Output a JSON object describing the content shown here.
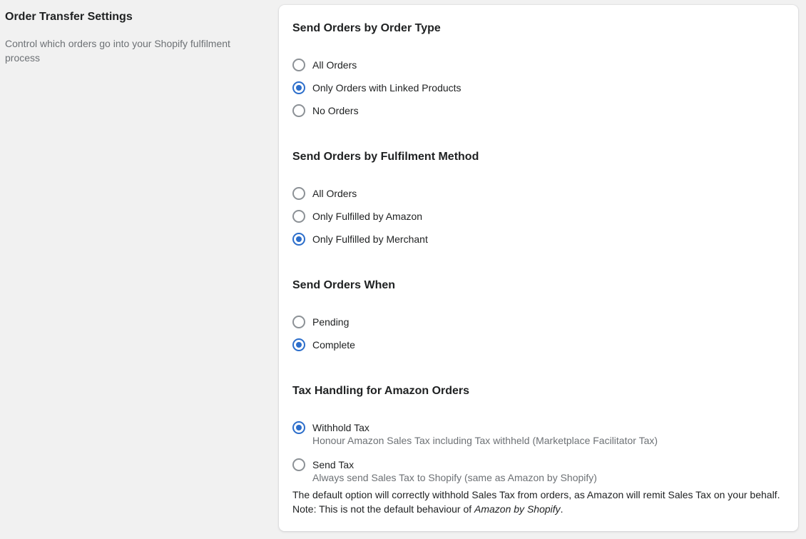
{
  "section": {
    "title": "Order Transfer Settings",
    "description": "Control which orders go into your Shopify fulfilment process"
  },
  "groups": [
    {
      "heading": "Send Orders by Order Type",
      "options": [
        {
          "label": "All Orders",
          "checked": false
        },
        {
          "label": "Only Orders with Linked Products",
          "checked": true
        },
        {
          "label": "No Orders",
          "checked": false
        }
      ]
    },
    {
      "heading": "Send Orders by Fulfilment Method",
      "options": [
        {
          "label": "All Orders",
          "checked": false
        },
        {
          "label": "Only Fulfilled by Amazon",
          "checked": false
        },
        {
          "label": "Only Fulfilled by Merchant",
          "checked": true
        }
      ]
    },
    {
      "heading": "Send Orders When",
      "options": [
        {
          "label": "Pending",
          "checked": false
        },
        {
          "label": "Complete",
          "checked": true
        }
      ]
    },
    {
      "heading": "Tax Handling for Amazon Orders",
      "options": [
        {
          "label": "Withhold Tax",
          "checked": true,
          "help": "Honour Amazon Sales Tax including Tax withheld (Marketplace Facilitator Tax)"
        },
        {
          "label": "Send Tax",
          "checked": false,
          "help": "Always send Sales Tax to Shopify (same as Amazon by Shopify)"
        }
      ]
    }
  ],
  "note": {
    "line1": "The default option will correctly withhold Sales Tax from orders, as Amazon will remit Sales Tax on your behalf.",
    "line2_prefix": "Note: This is not the default behaviour of ",
    "line2_emphasis": "Amazon by Shopify",
    "line2_suffix": "."
  },
  "colors": {
    "accent": "#2c6ecb",
    "page_background": "#f1f1f1",
    "card_background": "#ffffff",
    "subdued_text": "#6d7175"
  }
}
